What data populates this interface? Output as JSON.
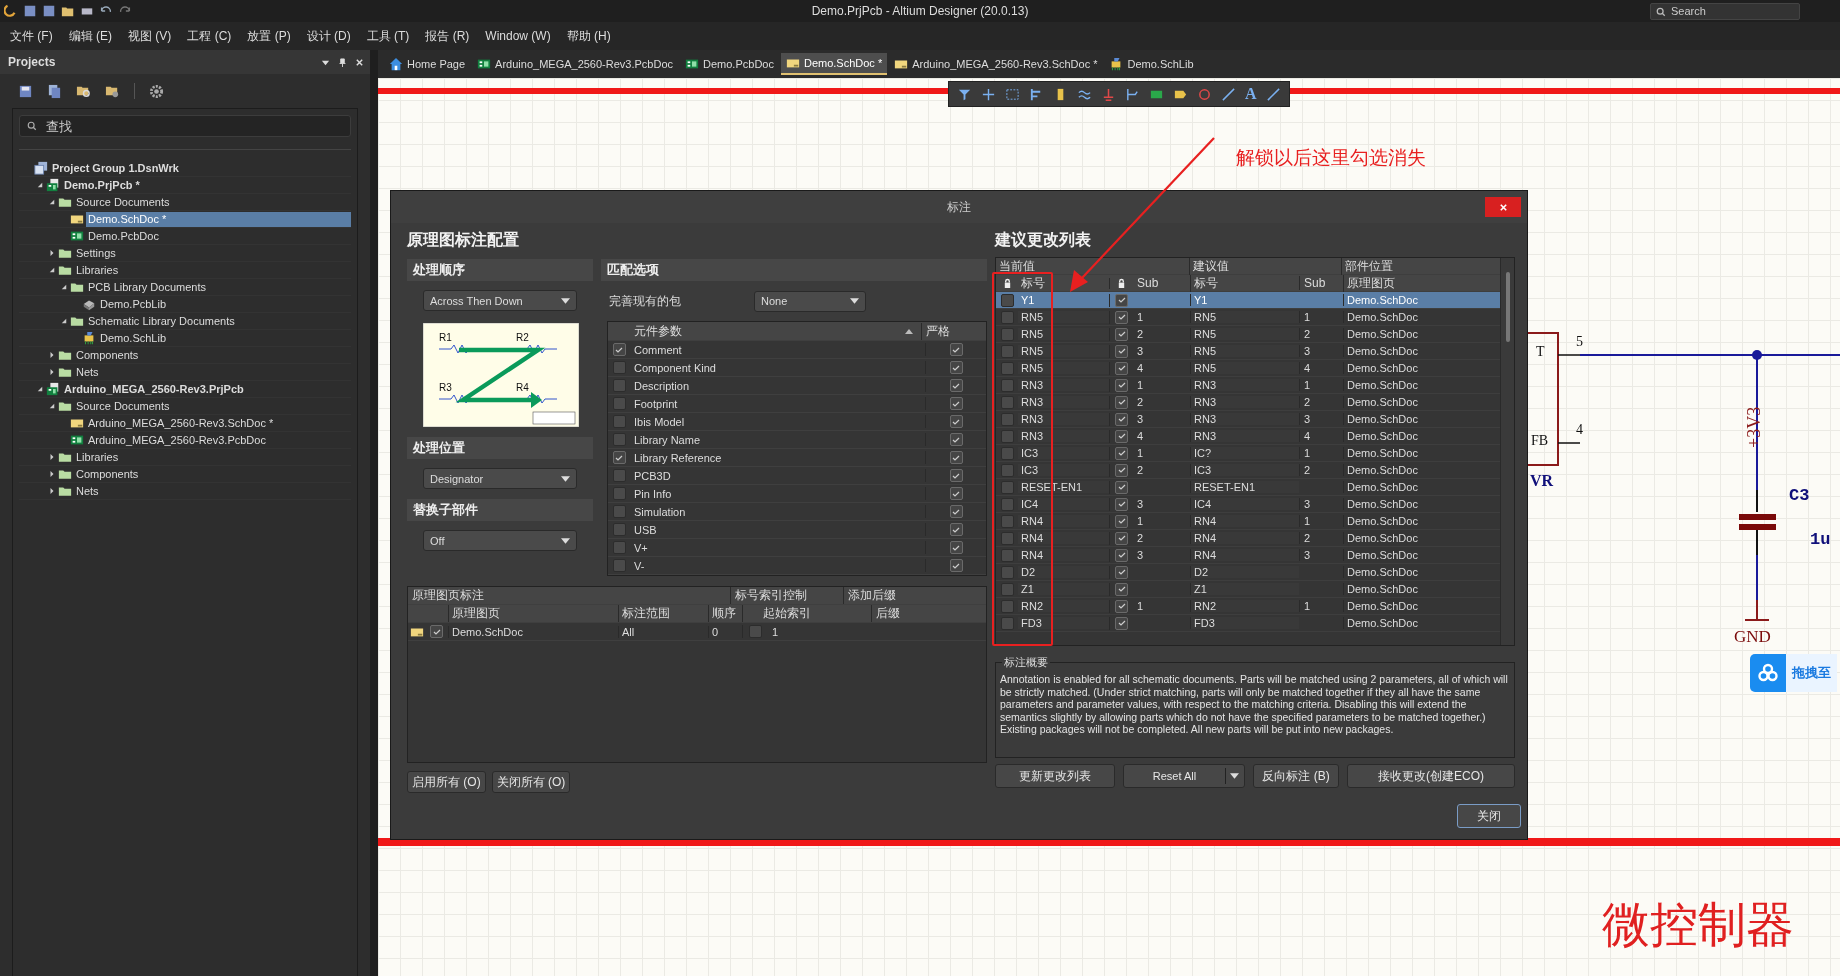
{
  "title_bar": {
    "title": "Demo.PrjPcb - Altium Designer (20.0.13)",
    "search_placeholder": "Search"
  },
  "menu": [
    "文件 (F)",
    "编辑 (E)",
    "视图 (V)",
    "工程 (C)",
    "放置 (P)",
    "设计 (D)",
    "工具 (T)",
    "报告 (R)",
    "Window (W)",
    "帮助 (H)"
  ],
  "projects_panel": {
    "title": "Projects",
    "search_placeholder": "查找",
    "tree": [
      {
        "label": "Project Group 1.DsnWrk",
        "kind": "group",
        "selected": false,
        "children": [
          {
            "label": "Demo.PrjPcb *",
            "kind": "project",
            "expanded": true,
            "selected": false,
            "children": [
              {
                "label": "Source Documents",
                "kind": "folder",
                "expanded": true,
                "selected": false,
                "children": [
                  {
                    "label": "Demo.SchDoc *",
                    "kind": "sch",
                    "selected": true
                  },
                  {
                    "label": "Demo.PcbDoc",
                    "kind": "pcb",
                    "selected": false
                  }
                ]
              },
              {
                "label": "Settings",
                "kind": "folder",
                "expanded": false,
                "selected": false
              },
              {
                "label": "Libraries",
                "kind": "folder",
                "expanded": true,
                "selected": false,
                "children": [
                  {
                    "label": "PCB Library Documents",
                    "kind": "folder",
                    "expanded": true,
                    "selected": false,
                    "children": [
                      {
                        "label": "Demo.PcbLib",
                        "kind": "pcblib",
                        "selected": false
                      }
                    ]
                  },
                  {
                    "label": "Schematic Library Documents",
                    "kind": "folder",
                    "expanded": true,
                    "selected": false,
                    "children": [
                      {
                        "label": "Demo.SchLib",
                        "kind": "schlib",
                        "selected": false
                      }
                    ]
                  }
                ]
              },
              {
                "label": "Components",
                "kind": "folder",
                "expanded": false,
                "selected": false
              },
              {
                "label": "Nets",
                "kind": "folder",
                "expanded": false,
                "selected": false
              }
            ]
          },
          {
            "label": "Arduino_MEGA_2560-Rev3.PrjPcb",
            "kind": "project",
            "expanded": true,
            "selected": false,
            "children": [
              {
                "label": "Source Documents",
                "kind": "folder",
                "expanded": true,
                "selected": false,
                "children": [
                  {
                    "label": "Arduino_MEGA_2560-Rev3.SchDoc *",
                    "kind": "sch",
                    "selected": false
                  },
                  {
                    "label": "Arduino_MEGA_2560-Rev3.PcbDoc",
                    "kind": "pcb",
                    "selected": false
                  }
                ]
              },
              {
                "label": "Libraries",
                "kind": "folder",
                "expanded": false,
                "selected": false
              },
              {
                "label": "Components",
                "kind": "folder",
                "expanded": false,
                "selected": false
              },
              {
                "label": "Nets",
                "kind": "folder",
                "expanded": false,
                "selected": false
              }
            ]
          }
        ]
      }
    ]
  },
  "doc_tabs": [
    {
      "label": "Home Page",
      "kind": "home",
      "selected": false
    },
    {
      "label": "Arduino_MEGA_2560-Rev3.PcbDoc",
      "kind": "pcb",
      "selected": false
    },
    {
      "label": "Demo.PcbDoc",
      "kind": "pcb",
      "selected": false
    },
    {
      "label": "Demo.SchDoc *",
      "kind": "sch",
      "selected": true
    },
    {
      "label": "Arduino_MEGA_2560-Rev3.SchDoc *",
      "kind": "sch",
      "selected": false
    },
    {
      "label": "Demo.SchLib",
      "kind": "schlib",
      "selected": false
    }
  ],
  "schematic_toolbar": {
    "text_tool": "A"
  },
  "dialog": {
    "title": "标注",
    "config": {
      "heading": "原理图标注配置",
      "order": {
        "title": "处理顺序",
        "value": "Across Then Down",
        "diagram_labels": [
          "R1",
          "R2",
          "R3",
          "R4"
        ]
      },
      "location": {
        "title": "处理位置",
        "value": "Designator"
      },
      "replace": {
        "title": "替换子部件",
        "value": "Off"
      },
      "matching": {
        "title": "匹配选项",
        "package_label": "完善现有的包",
        "package_value": "None",
        "columns": [
          "元件参数",
          "严格"
        ],
        "params": [
          {
            "name": "Comment",
            "checked": true,
            "strict": true
          },
          {
            "name": "Component Kind",
            "checked": false,
            "strict": true
          },
          {
            "name": "Description",
            "checked": false,
            "strict": true
          },
          {
            "name": "Footprint",
            "checked": false,
            "strict": true
          },
          {
            "name": "Ibis Model",
            "checked": false,
            "strict": true
          },
          {
            "name": "Library Name",
            "checked": false,
            "strict": true
          },
          {
            "name": "Library Reference",
            "checked": true,
            "strict": true
          },
          {
            "name": "PCB3D",
            "checked": false,
            "strict": true
          },
          {
            "name": "Pin Info",
            "checked": false,
            "strict": true
          },
          {
            "name": "Simulation",
            "checked": false,
            "strict": true
          },
          {
            "name": "USB",
            "checked": false,
            "strict": true
          },
          {
            "name": "V+",
            "checked": false,
            "strict": true
          },
          {
            "name": "V-",
            "checked": false,
            "strict": true
          }
        ]
      },
      "sheets": {
        "groups": [
          "原理图页标注",
          "标号索引控制",
          "添加后缀"
        ],
        "columns": [
          "原理图页",
          "标注范围",
          "顺序",
          "起始索引",
          "后缀"
        ],
        "rows": [
          {
            "enabled": true,
            "sheet": "Demo.SchDoc",
            "scope": "All",
            "order": "0",
            "index_on": false,
            "start": "1"
          }
        ]
      },
      "buttons": [
        "启用所有 (O)",
        "关闭所有 (O)"
      ]
    },
    "changes": {
      "heading": "建议更改列表",
      "groups": [
        "当前值",
        "建议值",
        "部件位置"
      ],
      "columns": [
        "标号",
        "Sub",
        "标号",
        "Sub",
        "原理图页"
      ],
      "rows": [
        {
          "lock": false,
          "designator": "Y1",
          "sub_lock": true,
          "new_designator": "Y1",
          "sheet": "Demo.SchDoc",
          "selected": true
        },
        {
          "lock": false,
          "designator": "RN5",
          "sub_lock": true,
          "sub": "1",
          "new_designator": "RN5",
          "new_sub": "1",
          "sheet": "Demo.SchDoc",
          "selected": false
        },
        {
          "lock": false,
          "designator": "RN5",
          "sub_lock": true,
          "sub": "2",
          "new_designator": "RN5",
          "new_sub": "2",
          "sheet": "Demo.SchDoc",
          "selected": false
        },
        {
          "lock": false,
          "designator": "RN5",
          "sub_lock": true,
          "sub": "3",
          "new_designator": "RN5",
          "new_sub": "3",
          "sheet": "Demo.SchDoc",
          "selected": false
        },
        {
          "lock": false,
          "designator": "RN5",
          "sub_lock": true,
          "sub": "4",
          "new_designator": "RN5",
          "new_sub": "4",
          "sheet": "Demo.SchDoc",
          "selected": false
        },
        {
          "lock": false,
          "designator": "RN3",
          "sub_lock": true,
          "sub": "1",
          "new_designator": "RN3",
          "new_sub": "1",
          "sheet": "Demo.SchDoc",
          "selected": false
        },
        {
          "lock": false,
          "designator": "RN3",
          "sub_lock": true,
          "sub": "2",
          "new_designator": "RN3",
          "new_sub": "2",
          "sheet": "Demo.SchDoc",
          "selected": false
        },
        {
          "lock": false,
          "designator": "RN3",
          "sub_lock": true,
          "sub": "3",
          "new_designator": "RN3",
          "new_sub": "3",
          "sheet": "Demo.SchDoc",
          "selected": false
        },
        {
          "lock": false,
          "designator": "RN3",
          "sub_lock": true,
          "sub": "4",
          "new_designator": "RN3",
          "new_sub": "4",
          "sheet": "Demo.SchDoc",
          "selected": false
        },
        {
          "lock": false,
          "designator": "IC3",
          "sub_lock": true,
          "sub": "1",
          "new_designator": "IC?",
          "new_sub": "1",
          "sheet": "Demo.SchDoc",
          "selected": false
        },
        {
          "lock": false,
          "designator": "IC3",
          "sub_lock": true,
          "sub": "2",
          "new_designator": "IC3",
          "new_sub": "2",
          "sheet": "Demo.SchDoc",
          "selected": false
        },
        {
          "lock": false,
          "designator": "RESET-EN1",
          "sub_lock": true,
          "new_designator": "RESET-EN1",
          "sheet": "Demo.SchDoc",
          "selected": false
        },
        {
          "lock": false,
          "designator": "IC4",
          "sub_lock": true,
          "sub": "3",
          "new_designator": "IC4",
          "new_sub": "3",
          "sheet": "Demo.SchDoc",
          "selected": false
        },
        {
          "lock": false,
          "designator": "RN4",
          "sub_lock": true,
          "sub": "1",
          "new_designator": "RN4",
          "new_sub": "1",
          "sheet": "Demo.SchDoc",
          "selected": false
        },
        {
          "lock": false,
          "designator": "RN4",
          "sub_lock": true,
          "sub": "2",
          "new_designator": "RN4",
          "new_sub": "2",
          "sheet": "Demo.SchDoc",
          "selected": false
        },
        {
          "lock": false,
          "designator": "RN4",
          "sub_lock": true,
          "sub": "3",
          "new_designator": "RN4",
          "new_sub": "3",
          "sheet": "Demo.SchDoc",
          "selected": false
        },
        {
          "lock": false,
          "designator": "D2",
          "sub_lock": true,
          "new_designator": "D2",
          "sheet": "Demo.SchDoc",
          "selected": false
        },
        {
          "lock": false,
          "designator": "Z1",
          "sub_lock": true,
          "new_designator": "Z1",
          "sheet": "Demo.SchDoc",
          "selected": false
        },
        {
          "lock": false,
          "designator": "RN2",
          "sub_lock": true,
          "sub": "1",
          "new_designator": "RN2",
          "new_sub": "1",
          "sheet": "Demo.SchDoc",
          "selected": false
        },
        {
          "lock": false,
          "designator": "FD3",
          "sub_lock": true,
          "new_designator": "FD3",
          "sheet": "Demo.SchDoc",
          "selected": false
        }
      ]
    },
    "summary": {
      "title": "标注概要",
      "text": "Annotation is enabled for all schematic documents. Parts will be matched using 2 parameters, all of which will be strictly matched. (Under strict matching, parts will only be matched together if they all have the same parameters and parameter values, with respect to the matching criteria. Disabling this will extend the semantics slightly by allowing parts which do not have the specified parameters to be matched together.) Existing packages will not be completed. All new parts will be put into new packages."
    },
    "actions": [
      {
        "label": "更新更改列表",
        "kind": "button"
      },
      {
        "label": "Reset All",
        "kind": "split"
      },
      {
        "label": "反向标注 (B)",
        "kind": "button"
      },
      {
        "label": "接收更改(创建ECO)",
        "kind": "button"
      }
    ],
    "close": "关闭"
  },
  "schematic": {
    "pin_labels": [
      "T",
      "FB"
    ],
    "part_suffix": "VR",
    "pins": [
      "5",
      "4"
    ],
    "net": "+3V3",
    "cap_designator": "C3",
    "cap_value": "1u",
    "ground": "GND"
  },
  "notes": {
    "callout": "解锁以后这里勾选消失",
    "caption": "微控制器"
  },
  "upload_button": "拖拽至"
}
